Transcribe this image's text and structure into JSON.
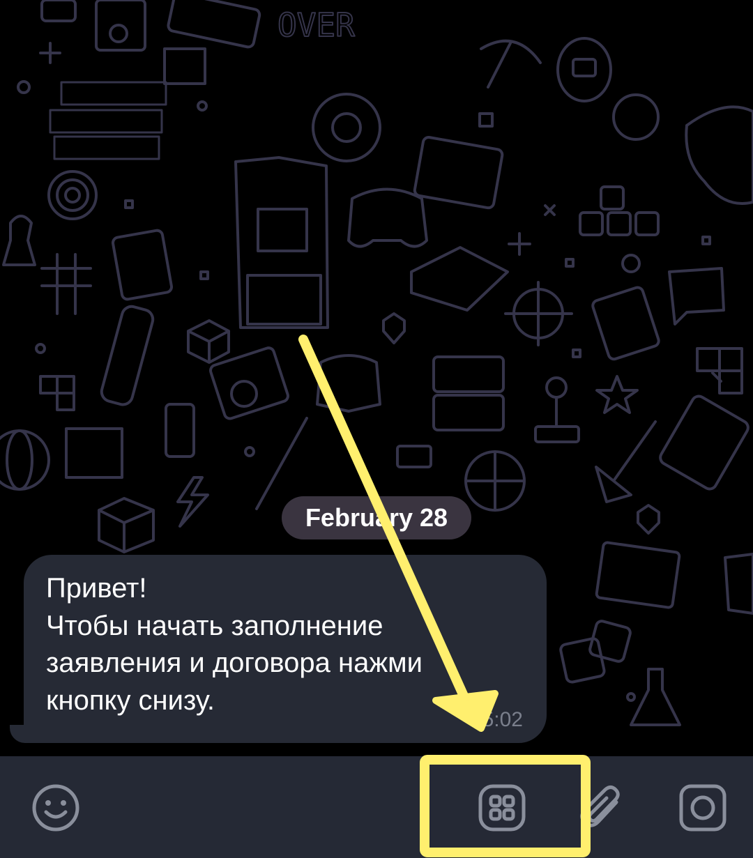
{
  "chat": {
    "date_separator": "February 28",
    "message": {
      "text": "Привет!\nЧтобы начать заполнение\nзаявления и договора нажми\nкнопку снизу.",
      "time": "15:02"
    }
  },
  "input_bar": {
    "icons": [
      "emoji-icon",
      "bot-menu-grid-icon",
      "attach-paperclip-icon",
      "camera-icon"
    ]
  },
  "annotation": {
    "arrow_color": "#ffef6e",
    "highlight_color": "#ffef6e"
  },
  "colors": {
    "background": "#000000",
    "bubble": "#262a35",
    "input_bar": "#252935",
    "doodle_stroke": "#35344a",
    "icon_gray": "#8a8f9c"
  }
}
